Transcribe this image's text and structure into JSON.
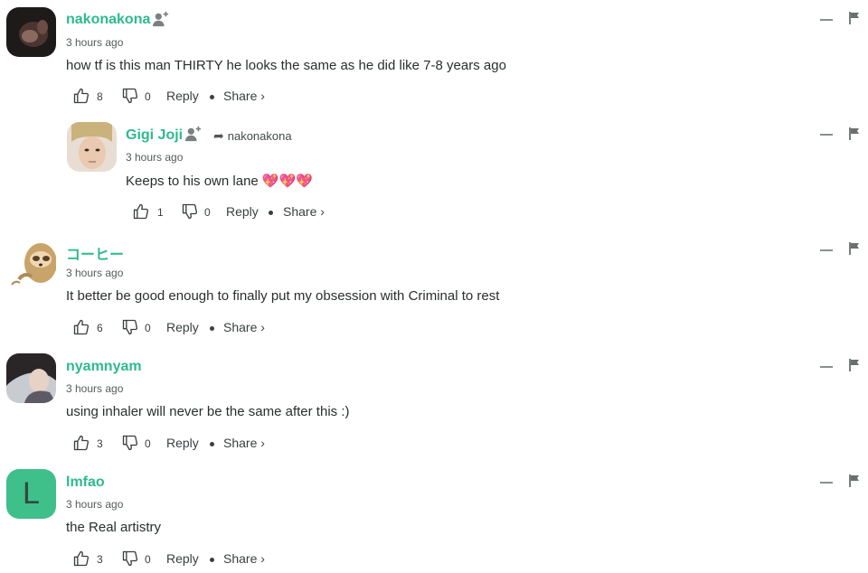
{
  "comments": [
    {
      "username": "nakonakona",
      "timestamp": "3 hours ago",
      "text": "how tf is this man THIRTY he looks the same as he did like 7-8 years ago",
      "likes": "8",
      "dislikes": "0",
      "reply_label": "Reply",
      "share_label": "Share ›",
      "avatar": "photo"
    },
    {
      "username": "Gigi Joji",
      "reply_to": "nakonakona",
      "timestamp": "3 hours ago",
      "text": "Keeps to his own lane 💖💖💖",
      "likes": "1",
      "dislikes": "0",
      "reply_label": "Reply",
      "share_label": "Share ›",
      "avatar": "photo"
    },
    {
      "username": "コーヒー",
      "timestamp": "3 hours ago",
      "text": "It better be good enough to finally put my obsession with Criminal to rest",
      "likes": "6",
      "dislikes": "0",
      "reply_label": "Reply",
      "share_label": "Share ›",
      "avatar": "sloth-illustration"
    },
    {
      "username": "nyamnyam",
      "timestamp": "3 hours ago",
      "text": "using inhaler will never be the same after this :)",
      "likes": "3",
      "dislikes": "0",
      "reply_label": "Reply",
      "share_label": "Share ›",
      "avatar": "photo"
    },
    {
      "username": "lmfao",
      "timestamp": "3 hours ago",
      "text": "the Real artistry",
      "likes": "3",
      "dislikes": "0",
      "reply_label": "Reply",
      "share_label": "Share ›",
      "avatar_letter": "L"
    }
  ],
  "colors": {
    "username": "#2dba8e",
    "letter_avatar_bg": "#3fbf8a"
  },
  "icons": [
    "follow-user-icon",
    "reply-arrow-icon",
    "thumbs-up-icon",
    "thumbs-down-icon",
    "collapse-icon",
    "flag-icon"
  ]
}
